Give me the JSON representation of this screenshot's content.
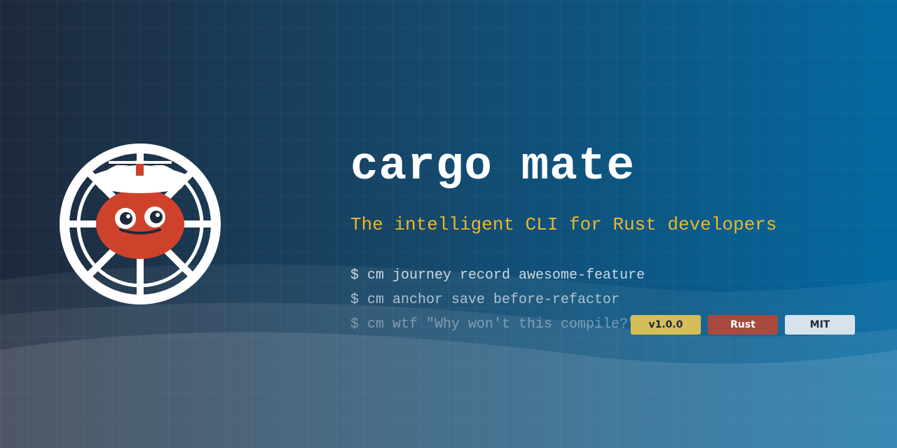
{
  "title": "cargo mate",
  "subtitle": "The intelligent CLI for Rust developers",
  "commands": [
    "$ cm journey record awesome-feature",
    "$ cm anchor save before-refactor",
    "$ cm wtf \"Why won't this compile?\""
  ],
  "badges": [
    {
      "label": "v1.0.0",
      "color": "#d4be5a"
    },
    {
      "label": "Rust",
      "color": "#a84a40"
    },
    {
      "label": "MIT",
      "color": "#d6e3ec"
    }
  ],
  "logo": {
    "icon": "ship-wheel-crab-sailor-icon",
    "accent": "#ce422b"
  }
}
